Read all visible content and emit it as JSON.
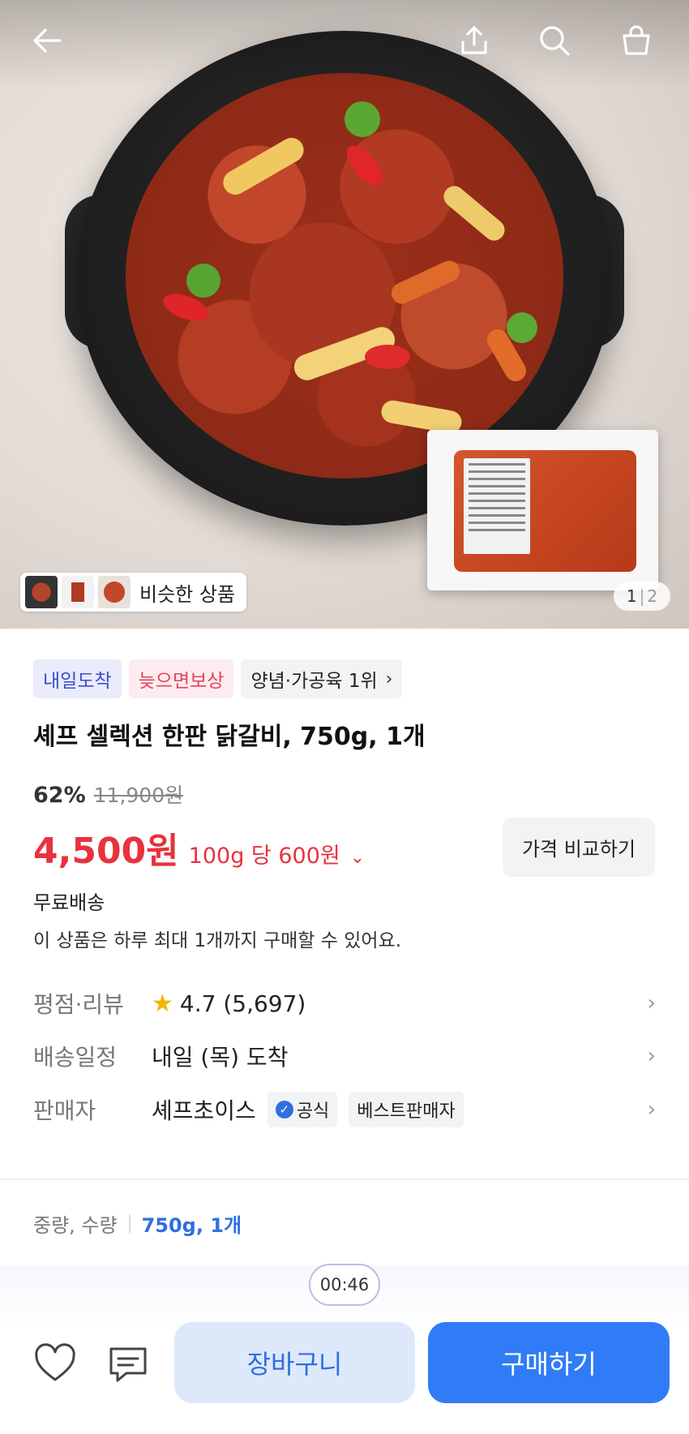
{
  "hero": {
    "similar_label": "비슷한 상품",
    "pager_current": "1",
    "pager_total": "2"
  },
  "badges": {
    "arrival": "내일도착",
    "late_comp": "늦으면보상",
    "rank": "양념·가공육 1위"
  },
  "product": {
    "title": "셰프 셀렉션 한판 닭갈비, 750g, 1개",
    "discount": "62%",
    "original_price": "11,900원",
    "price": "4,500원",
    "unit_price": "100g 당 600원",
    "compare_label": "가격 비교하기",
    "free_shipping": "무료배송",
    "purchase_limit": "이 상품은 하루 최대 1개까지 구매할 수 있어요."
  },
  "info": {
    "rating_key": "평점·리뷰",
    "rating_value": "4.7 (5,697)",
    "shipping_key": "배송일정",
    "shipping_value": "내일 (목) 도착",
    "seller_key": "판매자",
    "seller_name": "셰프초이스",
    "official_tag": "공식",
    "best_seller_tag": "베스트판매자"
  },
  "option": {
    "key": "중량, 수량",
    "value": "750g, 1개"
  },
  "bottom": {
    "timer": "00:46",
    "cart_label": "장바구니",
    "buy_label": "구매하기"
  },
  "colors": {
    "accent_blue": "#2f7cf6",
    "price_red": "#e8323d"
  }
}
